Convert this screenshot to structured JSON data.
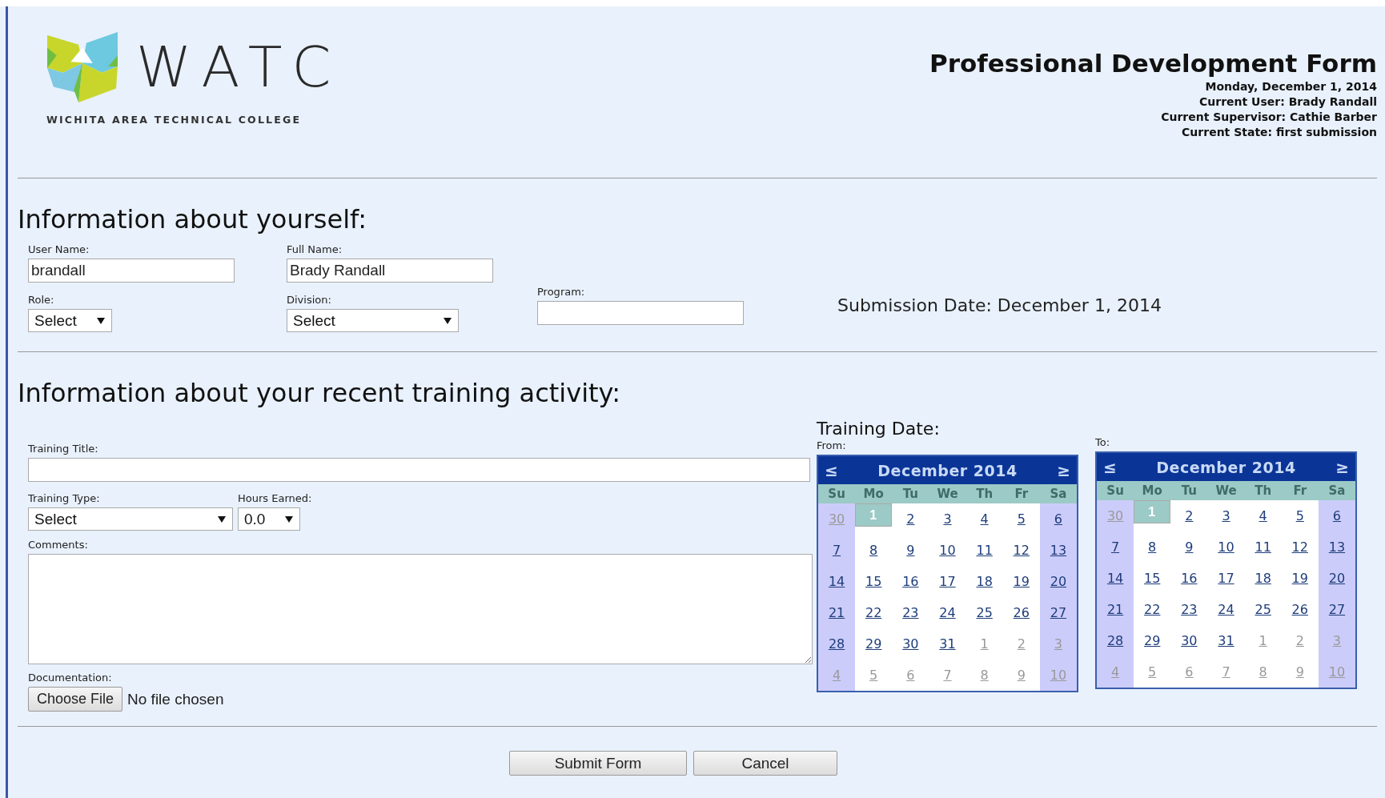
{
  "header": {
    "logo_text": "WATC",
    "logo_subtitle": "WICHITA AREA TECHNICAL COLLEGE",
    "title": "Professional Development Form",
    "meta": [
      "Monday, December 1, 2014",
      "Current User: Brady Randall",
      "Current Supervisor: Cathie Barber",
      "Current State: first submission"
    ]
  },
  "about": {
    "heading": "Information about yourself:",
    "user_name": {
      "label": "User Name:",
      "value": "brandall"
    },
    "full_name": {
      "label": "Full Name:",
      "value": "Brady Randall"
    },
    "role": {
      "label": "Role:",
      "value": "Select"
    },
    "division": {
      "label": "Division:",
      "value": "Select"
    },
    "program": {
      "label": "Program:"
    },
    "submission_date": "Submission Date: December 1, 2014"
  },
  "training": {
    "heading": "Information about your recent training activity:",
    "title": {
      "label": "Training Title:"
    },
    "type": {
      "label": "Training Type:",
      "value": "Select"
    },
    "hours": {
      "label": "Hours Earned:",
      "value": "0.0"
    },
    "comments": {
      "label": "Comments:"
    },
    "documentation": {
      "label": "Documentation:",
      "button": "Choose File",
      "status": "No file chosen"
    },
    "date_heading": "Training Date:",
    "calendars": [
      {
        "label": "From:",
        "month": "December 2014",
        "prev": "≤",
        "next": "≥",
        "weekdays": [
          "Su",
          "Mo",
          "Tu",
          "We",
          "Th",
          "Fr",
          "Sa"
        ],
        "weeks": [
          [
            {
              "day": "30",
              "other_month": true,
              "selected": false
            },
            {
              "day": "1",
              "other_month": false,
              "selected": true
            },
            {
              "day": "2",
              "other_month": false,
              "selected": false
            },
            {
              "day": "3",
              "other_month": false,
              "selected": false
            },
            {
              "day": "4",
              "other_month": false,
              "selected": false
            },
            {
              "day": "5",
              "other_month": false,
              "selected": false
            },
            {
              "day": "6",
              "other_month": false,
              "selected": false
            }
          ],
          [
            {
              "day": "7",
              "other_month": false,
              "selected": false
            },
            {
              "day": "8",
              "other_month": false,
              "selected": false
            },
            {
              "day": "9",
              "other_month": false,
              "selected": false
            },
            {
              "day": "10",
              "other_month": false,
              "selected": false
            },
            {
              "day": "11",
              "other_month": false,
              "selected": false
            },
            {
              "day": "12",
              "other_month": false,
              "selected": false
            },
            {
              "day": "13",
              "other_month": false,
              "selected": false
            }
          ],
          [
            {
              "day": "14",
              "other_month": false,
              "selected": false
            },
            {
              "day": "15",
              "other_month": false,
              "selected": false
            },
            {
              "day": "16",
              "other_month": false,
              "selected": false
            },
            {
              "day": "17",
              "other_month": false,
              "selected": false
            },
            {
              "day": "18",
              "other_month": false,
              "selected": false
            },
            {
              "day": "19",
              "other_month": false,
              "selected": false
            },
            {
              "day": "20",
              "other_month": false,
              "selected": false
            }
          ],
          [
            {
              "day": "21",
              "other_month": false,
              "selected": false
            },
            {
              "day": "22",
              "other_month": false,
              "selected": false
            },
            {
              "day": "23",
              "other_month": false,
              "selected": false
            },
            {
              "day": "24",
              "other_month": false,
              "selected": false
            },
            {
              "day": "25",
              "other_month": false,
              "selected": false
            },
            {
              "day": "26",
              "other_month": false,
              "selected": false
            },
            {
              "day": "27",
              "other_month": false,
              "selected": false
            }
          ],
          [
            {
              "day": "28",
              "other_month": false,
              "selected": false
            },
            {
              "day": "29",
              "other_month": false,
              "selected": false
            },
            {
              "day": "30",
              "other_month": false,
              "selected": false
            },
            {
              "day": "31",
              "other_month": false,
              "selected": false
            },
            {
              "day": "1",
              "other_month": true,
              "selected": false
            },
            {
              "day": "2",
              "other_month": true,
              "selected": false
            },
            {
              "day": "3",
              "other_month": true,
              "selected": false
            }
          ],
          [
            {
              "day": "4",
              "other_month": true,
              "selected": false
            },
            {
              "day": "5",
              "other_month": true,
              "selected": false
            },
            {
              "day": "6",
              "other_month": true,
              "selected": false
            },
            {
              "day": "7",
              "other_month": true,
              "selected": false
            },
            {
              "day": "8",
              "other_month": true,
              "selected": false
            },
            {
              "day": "9",
              "other_month": true,
              "selected": false
            },
            {
              "day": "10",
              "other_month": true,
              "selected": false
            }
          ]
        ]
      },
      {
        "label": "To:",
        "month": "December 2014",
        "prev": "≤",
        "next": "≥",
        "weekdays": [
          "Su",
          "Mo",
          "Tu",
          "We",
          "Th",
          "Fr",
          "Sa"
        ],
        "weeks": [
          [
            {
              "day": "30",
              "other_month": true,
              "selected": false
            },
            {
              "day": "1",
              "other_month": false,
              "selected": true
            },
            {
              "day": "2",
              "other_month": false,
              "selected": false
            },
            {
              "day": "3",
              "other_month": false,
              "selected": false
            },
            {
              "day": "4",
              "other_month": false,
              "selected": false
            },
            {
              "day": "5",
              "other_month": false,
              "selected": false
            },
            {
              "day": "6",
              "other_month": false,
              "selected": false
            }
          ],
          [
            {
              "day": "7",
              "other_month": false,
              "selected": false
            },
            {
              "day": "8",
              "other_month": false,
              "selected": false
            },
            {
              "day": "9",
              "other_month": false,
              "selected": false
            },
            {
              "day": "10",
              "other_month": false,
              "selected": false
            },
            {
              "day": "11",
              "other_month": false,
              "selected": false
            },
            {
              "day": "12",
              "other_month": false,
              "selected": false
            },
            {
              "day": "13",
              "other_month": false,
              "selected": false
            }
          ],
          [
            {
              "day": "14",
              "other_month": false,
              "selected": false
            },
            {
              "day": "15",
              "other_month": false,
              "selected": false
            },
            {
              "day": "16",
              "other_month": false,
              "selected": false
            },
            {
              "day": "17",
              "other_month": false,
              "selected": false
            },
            {
              "day": "18",
              "other_month": false,
              "selected": false
            },
            {
              "day": "19",
              "other_month": false,
              "selected": false
            },
            {
              "day": "20",
              "other_month": false,
              "selected": false
            }
          ],
          [
            {
              "day": "21",
              "other_month": false,
              "selected": false
            },
            {
              "day": "22",
              "other_month": false,
              "selected": false
            },
            {
              "day": "23",
              "other_month": false,
              "selected": false
            },
            {
              "day": "24",
              "other_month": false,
              "selected": false
            },
            {
              "day": "25",
              "other_month": false,
              "selected": false
            },
            {
              "day": "26",
              "other_month": false,
              "selected": false
            },
            {
              "day": "27",
              "other_month": false,
              "selected": false
            }
          ],
          [
            {
              "day": "28",
              "other_month": false,
              "selected": false
            },
            {
              "day": "29",
              "other_month": false,
              "selected": false
            },
            {
              "day": "30",
              "other_month": false,
              "selected": false
            },
            {
              "day": "31",
              "other_month": false,
              "selected": false
            },
            {
              "day": "1",
              "other_month": true,
              "selected": false
            },
            {
              "day": "2",
              "other_month": true,
              "selected": false
            },
            {
              "day": "3",
              "other_month": true,
              "selected": false
            }
          ],
          [
            {
              "day": "4",
              "other_month": true,
              "selected": false
            },
            {
              "day": "5",
              "other_month": true,
              "selected": false
            },
            {
              "day": "6",
              "other_month": true,
              "selected": false
            },
            {
              "day": "7",
              "other_month": true,
              "selected": false
            },
            {
              "day": "8",
              "other_month": true,
              "selected": false
            },
            {
              "day": "9",
              "other_month": true,
              "selected": false
            },
            {
              "day": "10",
              "other_month": true,
              "selected": false
            }
          ]
        ]
      }
    ]
  },
  "buttons": [
    "Submit Form",
    "Cancel"
  ]
}
